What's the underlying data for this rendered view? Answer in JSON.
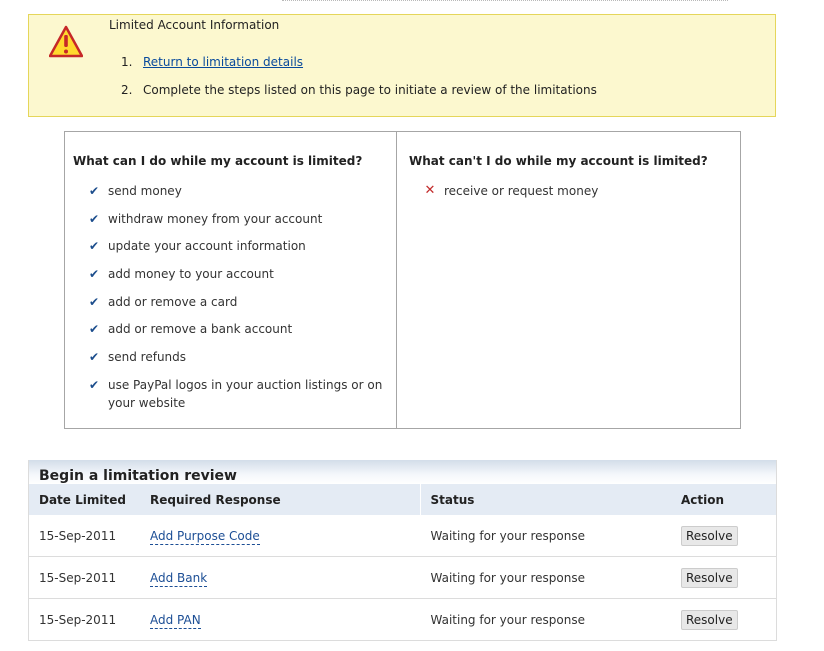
{
  "alert": {
    "title": "Limited Account Information",
    "icon": "warning-icon",
    "steps": [
      {
        "num": "1.",
        "text": "Return to limitation details",
        "link": true
      },
      {
        "num": "2.",
        "text": "Complete the steps listed on this page to initiate a review of the limitations",
        "link": false
      }
    ]
  },
  "limits": {
    "can_heading": "What can I do while my account is limited?",
    "can_items": [
      "send money",
      "withdraw money from your account",
      "update your account information",
      "add money to your account",
      "add or remove a card",
      "add or remove a bank account",
      "send refunds",
      "use PayPal logos in your auction listings or on your website"
    ],
    "cannot_heading": "What can't I do while my account is limited?",
    "cannot_items": [
      "receive or request money"
    ]
  },
  "review": {
    "title": "Begin a limitation review",
    "columns": [
      "Date Limited",
      "Required Response",
      "Status",
      "Action"
    ],
    "rows": [
      {
        "date": "15-Sep-2011",
        "response": "Add Purpose Code",
        "status": "Waiting for your response",
        "action": "Resolve"
      },
      {
        "date": "15-Sep-2011",
        "response": "Add Bank",
        "status": "Waiting for your response",
        "action": "Resolve"
      },
      {
        "date": "15-Sep-2011",
        "response": "Add PAN",
        "status": "Waiting for your response",
        "action": "Resolve"
      }
    ]
  },
  "colors": {
    "alert_bg": "#fcf8cf",
    "alert_border": "#e5d65a",
    "link": "#084a9c",
    "check": "#1c4d8c",
    "cross": "#c22b2b",
    "table_header_bg": "#e4ebf4"
  }
}
